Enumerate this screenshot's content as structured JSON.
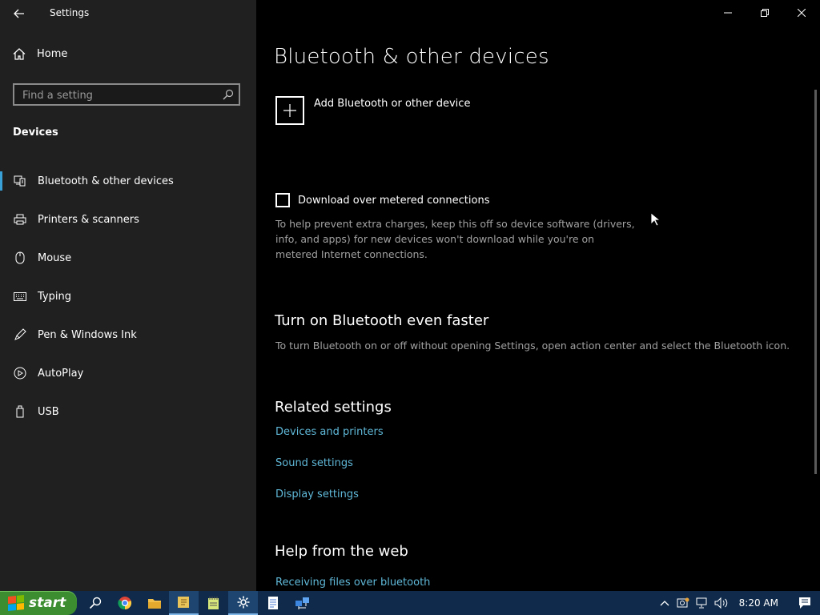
{
  "window": {
    "title": "Settings"
  },
  "sidebar": {
    "home_label": "Home",
    "search_placeholder": "Find a setting",
    "section_label": "Devices",
    "items": [
      {
        "label": "Bluetooth & other devices",
        "icon": "bluetooth-devices-icon",
        "active": true
      },
      {
        "label": "Printers & scanners",
        "icon": "printer-icon"
      },
      {
        "label": "Mouse",
        "icon": "mouse-icon"
      },
      {
        "label": "Typing",
        "icon": "keyboard-icon"
      },
      {
        "label": "Pen & Windows Ink",
        "icon": "pen-icon"
      },
      {
        "label": "AutoPlay",
        "icon": "autoplay-icon"
      },
      {
        "label": "USB",
        "icon": "usb-icon"
      }
    ]
  },
  "main": {
    "title": "Bluetooth & other devices",
    "add_device_label": "Add Bluetooth or other device",
    "metered_checkbox_label": "Download over metered connections",
    "metered_checked": false,
    "metered_description": "To help prevent extra charges, keep this off so device software (drivers, info, and apps) for new devices won't download while you're on metered Internet connections.",
    "faster_heading": "Turn on Bluetooth even faster",
    "faster_description": "To turn Bluetooth on or off without opening Settings, open action center and select the Bluetooth icon.",
    "related_heading": "Related settings",
    "related_links": [
      "Devices and printers",
      "Sound settings",
      "Display settings"
    ],
    "help_heading": "Help from the web",
    "help_links": [
      "Receiving files over bluetooth"
    ]
  },
  "taskbar": {
    "start_label": "start",
    "pinned": [
      "search-icon",
      "chrome-icon",
      "file-explorer-icon",
      "sticky-notes-icon",
      "notepad-icon",
      "settings-icon",
      "document-icon",
      "network-app-icon"
    ],
    "clock": "8:20 AM"
  },
  "colors": {
    "accent": "#3aa0d8",
    "link": "#5fb8d8",
    "sidebar_bg": "#202020",
    "main_bg": "#000000",
    "taskbar_bg": "#0f2a4a",
    "start_green": "#3c8d2f"
  }
}
